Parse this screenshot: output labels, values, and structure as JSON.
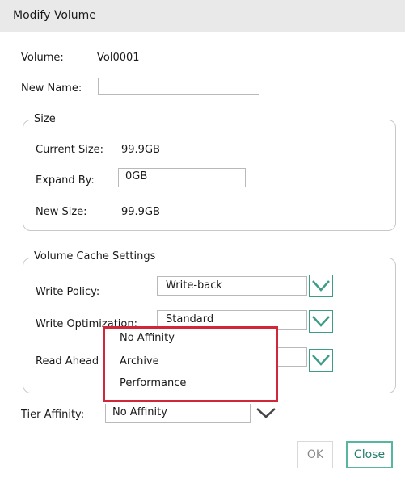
{
  "dialog": {
    "title": "Modify Volume"
  },
  "volume": {
    "label": "Volume:",
    "value": "Vol0001"
  },
  "new_name": {
    "label": "New Name:",
    "value": ""
  },
  "size": {
    "legend": "Size",
    "current_label": "Current Size:",
    "current_value": "99.9GB",
    "expand_label": "Expand By:",
    "expand_value": "0GB",
    "new_label": "New Size:",
    "new_value": "99.9GB"
  },
  "cache": {
    "legend": "Volume Cache Settings",
    "write_policy_label": "Write Policy:",
    "write_policy_value": "Write-back",
    "write_opt_label": "Write Optimization:",
    "write_opt_value": "Standard",
    "read_ahead_label": "Read Ahead"
  },
  "tier": {
    "label": "Tier Affinity:",
    "value": "No Affinity"
  },
  "tier_options": [
    "No Affinity",
    "Archive",
    "Performance"
  ],
  "buttons": {
    "ok": "OK",
    "close": "Close"
  },
  "colors": {
    "accent": "#56b6a0",
    "highlight": "#d1273a"
  },
  "icons": {
    "dropdown": "chevron-down-icon"
  }
}
